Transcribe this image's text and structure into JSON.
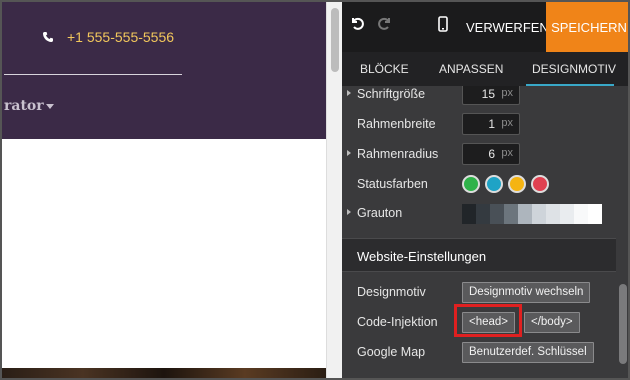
{
  "preview": {
    "phone": "+1 555-555-5556",
    "nav_item": "rator"
  },
  "topbar": {
    "undo_icon": "undo-icon",
    "redo_icon": "redo-icon",
    "device_icon": "mobile-phone-icon",
    "discard_label": "VERWERFEN",
    "save_label": "SPEICHERN",
    "save_color": "#f08418"
  },
  "tabs": [
    {
      "label": "BLÖCKE"
    },
    {
      "label": "ANPASSEN"
    },
    {
      "label": "DESIGNMOTIV",
      "active": true
    }
  ],
  "settings": {
    "font_size": {
      "label": "Schriftgröße",
      "value": "15",
      "unit": "px"
    },
    "border_width": {
      "label": "Rahmenbreite",
      "value": "1",
      "unit": "px"
    },
    "border_radius": {
      "label": "Rahmenradius",
      "value": "6",
      "unit": "px"
    },
    "status_colors": {
      "label": "Statusfarben",
      "colors": [
        "#2fb24a",
        "#1fa3c6",
        "#f5b412",
        "#e04050"
      ]
    },
    "gray_tones": {
      "label": "Grauton",
      "colors": [
        "#212529",
        "#343a40",
        "#495057",
        "#6c757d",
        "#adb5bd",
        "#ced4da",
        "#dee2e6",
        "#e9ecef",
        "#f8f9fa",
        "#ffffff"
      ]
    }
  },
  "website_settings": {
    "title": "Website-Einstellungen",
    "theme": {
      "label": "Designmotiv",
      "button": "Designmotiv wechseln"
    },
    "code_injection": {
      "label": "Code-Injektion",
      "head_button": "<head>",
      "body_button": "</body>"
    },
    "google_map": {
      "label": "Google Map",
      "button": "Benutzerdef. Schlüssel"
    }
  },
  "colors": {
    "highlight": "#e02020",
    "active_tab_underline": "#39a8c8"
  }
}
